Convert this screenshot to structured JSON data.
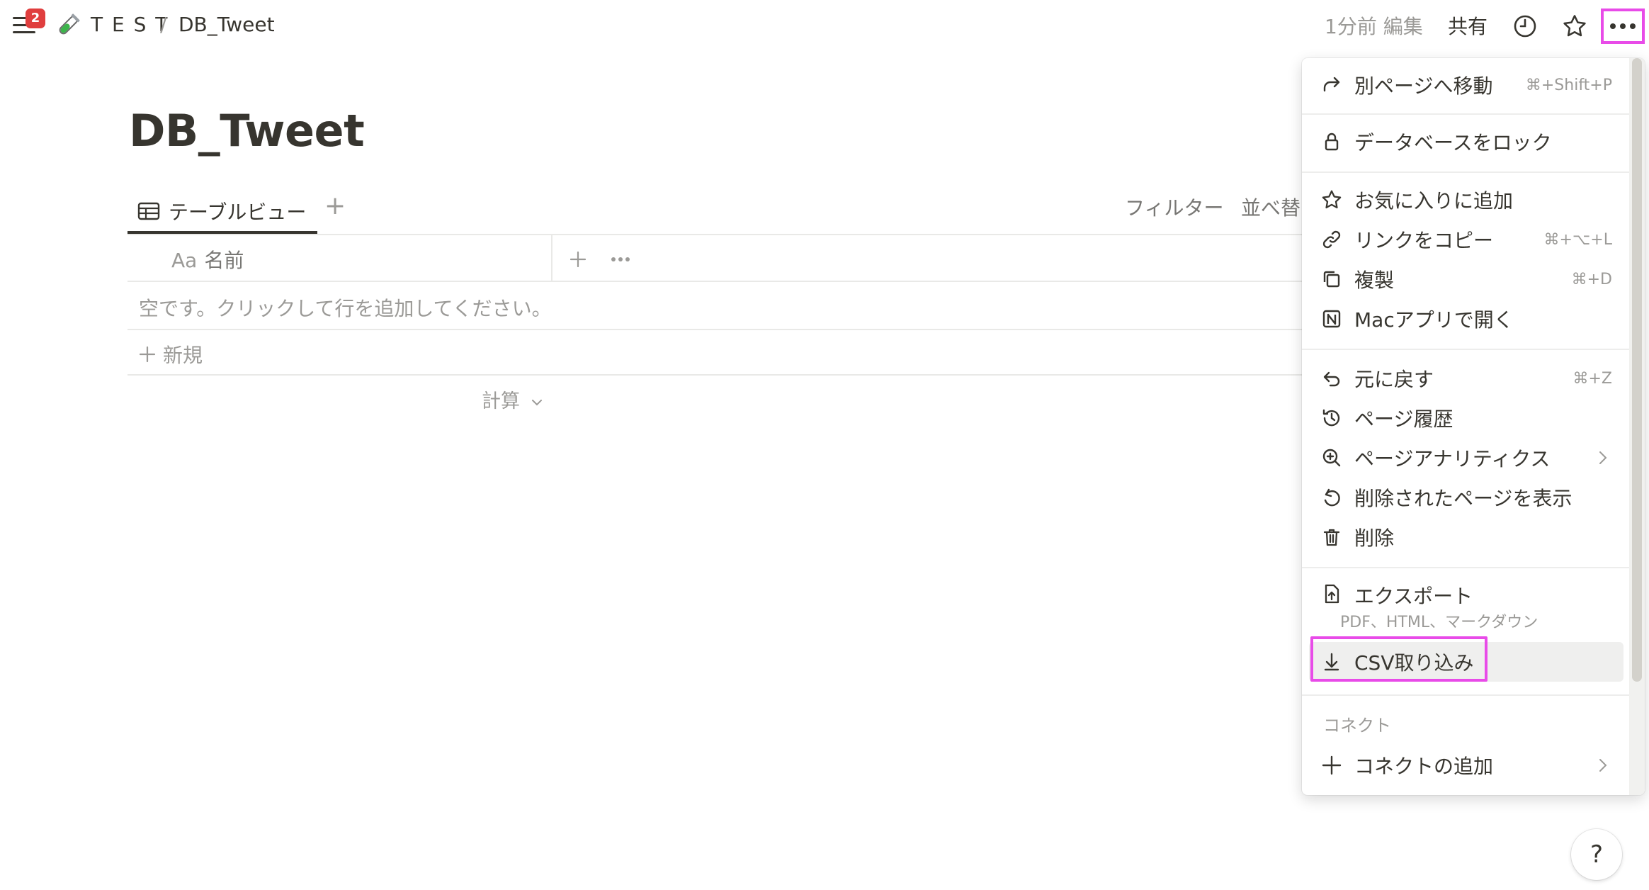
{
  "topbar": {
    "badge_count": "2",
    "breadcrumb_parent": "T E S T",
    "breadcrumb_sep": "/",
    "breadcrumb_current": "DB_Tweet",
    "edited": "1分前 編集",
    "share": "共有"
  },
  "page": {
    "title": "DB_Tweet",
    "view_tab": "テーブルビュー",
    "add_view": "+",
    "filter": "フィルター",
    "sort": "並べ替",
    "column_prefix": "Aa",
    "column_name": "名前",
    "empty_message": "空です。クリックして行を追加してください。",
    "new_row": "新規",
    "calculate": "計算"
  },
  "menu": {
    "items": [
      {
        "label": "別ページへ移動",
        "shortcut": "⌘+Shift+P",
        "icon": "arrow-redirect-icon"
      },
      {
        "label": "データベースをロック",
        "shortcut": "",
        "icon": "lock-icon"
      },
      {
        "label": "お気に入りに追加",
        "shortcut": "",
        "icon": "star-icon"
      },
      {
        "label": "リンクをコピー",
        "shortcut": "⌘+⌥+L",
        "icon": "link-icon"
      },
      {
        "label": "複製",
        "shortcut": "⌘+D",
        "icon": "duplicate-icon"
      },
      {
        "label": "Macアプリで開く",
        "shortcut": "",
        "icon": "notion-app-icon"
      },
      {
        "label": "元に戻す",
        "shortcut": "⌘+Z",
        "icon": "undo-icon"
      },
      {
        "label": "ページ履歴",
        "shortcut": "",
        "icon": "history-icon"
      },
      {
        "label": "ページアナリティクス",
        "shortcut": "",
        "icon": "analytics-icon"
      },
      {
        "label": "削除されたページを表示",
        "shortcut": "",
        "icon": "restore-icon"
      },
      {
        "label": "削除",
        "shortcut": "",
        "icon": "trash-icon"
      },
      {
        "label": "エクスポート",
        "shortcut": "",
        "icon": "export-icon"
      },
      {
        "label": "CSV取り込み",
        "shortcut": "",
        "icon": "download-icon"
      },
      {
        "label": "コネクトの追加",
        "shortcut": "",
        "icon": "plus-icon"
      }
    ],
    "export_sub": "PDF、HTML、マークダウン",
    "connect_section": "コネクト"
  },
  "help": {
    "label": "?"
  },
  "colors": {
    "highlight": "#e84be8",
    "badge": "#e03e3e",
    "text": "#37352f",
    "muted": "#9b9a97"
  }
}
